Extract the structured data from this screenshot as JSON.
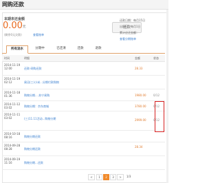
{
  "header": {
    "title": "网购还款"
  },
  "summary": {
    "label": "本期未还金额",
    "amount": "0.00",
    "unit": "元",
    "note": "(剩余0元欠款)",
    "view_bill": "查看账单",
    "repay_button": "还款"
  },
  "right_info": {
    "line1": "还款日期：每月15日",
    "line2": "出账日：每月1日",
    "line3": "累计应还金额：",
    "link": "查看分期账单"
  },
  "tabs": [
    {
      "label": "所有流水",
      "active": true
    },
    {
      "label": "分期中"
    },
    {
      "label": "已还清"
    },
    {
      "label": "还款"
    },
    {
      "label": "退款"
    }
  ],
  "table": {
    "columns": [
      "时间",
      "明细",
      "金额",
      "状态"
    ],
    "rows": [
      {
        "date": "2014-11-19\n12:00",
        "desc": "还款-网购还款",
        "amount": "28.33",
        "status": ""
      },
      {
        "date": "2014-11-19\n02:12",
        "desc": "易迅(三)小米...分期付款购物",
        "amount": "",
        "status": ""
      },
      {
        "date": "2014-11-18\n01:36",
        "desc": "购物分期... 苏宁易购",
        "amount": "1980.00",
        "status": "0/12"
      },
      {
        "date": "2014-11-12\n03:02",
        "desc": "购物分期：京东商城",
        "amount": "3780.00",
        "status": "0/12"
      },
      {
        "date": "2014-11-11\n03:02",
        "desc": "(三)11.11活动...购物分期",
        "amount": "2999.00",
        "status": "0/12"
      },
      {
        "date": "2014-10-18\n08:16",
        "desc": "购物分期还款",
        "amount": "",
        "status": ""
      },
      {
        "date": "2014-09-28\n08:28",
        "desc": "购物分期还款",
        "amount": "28.34",
        "status": ""
      },
      {
        "date": "2014-09-19\n11:16",
        "desc": "购物分期...还款",
        "amount": "",
        "status": ""
      }
    ]
  },
  "pager": {
    "prev": "<",
    "pages": [
      "1",
      "2",
      "3"
    ],
    "next": ">",
    "info": "1/3"
  }
}
